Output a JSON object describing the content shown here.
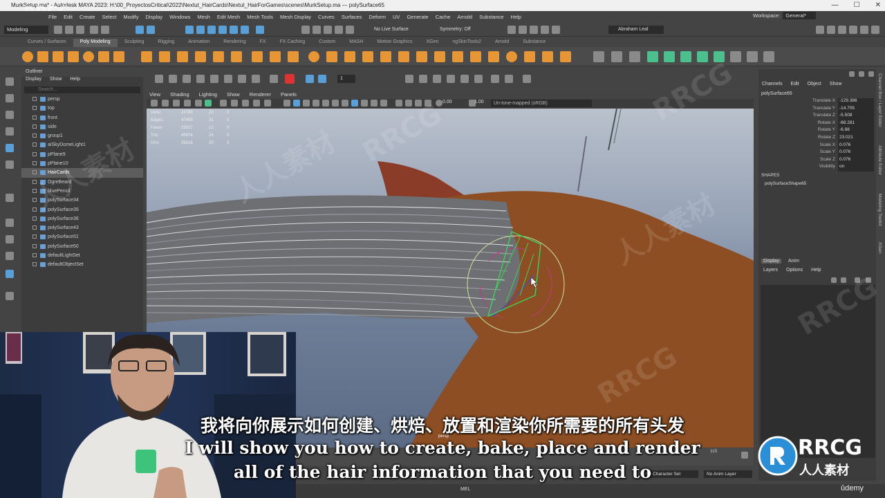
{
  "window": {
    "title": "MurkSetup.ma* - Autodesk MAYA 2023: H:\\00_ProyectosCritical\\2022\\Nextut_HairCards\\Nextut_HairForGames\\scenes\\MurkSetup.ma  ---  polySurface65",
    "minimize": "—",
    "maximize": "☐",
    "close": "✕"
  },
  "menubar": [
    "File",
    "Edit",
    "Create",
    "Select",
    "Modify",
    "Display",
    "Windows",
    "Mesh",
    "Edit Mesh",
    "Mesh Tools",
    "Mesh Display",
    "Curves",
    "Surfaces",
    "Deform",
    "UV",
    "Generate",
    "Cache",
    "Arnold",
    "Substance",
    "Help"
  ],
  "workspace": {
    "label": "Workspace:",
    "value": "General*"
  },
  "statusline": {
    "mode": "Modeling",
    "live_surface": "No Live Surface",
    "symmetry": "Symmetry: Off",
    "user": "Abraham Leal"
  },
  "shelf_tabs": [
    "Curves / Surfaces",
    "Poly Modeling",
    "Sculpting",
    "Rigging",
    "Animation",
    "Rendering",
    "FX",
    "FX Caching",
    "Custom",
    "MASH",
    "Motion Graphics",
    "XGen",
    "ngSkinTools2",
    "Arnold",
    "Substance"
  ],
  "shelf_active": "Poly Modeling",
  "outliner": {
    "title": "Outliner",
    "menu": [
      "Display",
      "Show",
      "Help"
    ],
    "search_placeholder": "Search...",
    "items": [
      {
        "label": "persp",
        "selected": false
      },
      {
        "label": "top",
        "selected": false
      },
      {
        "label": "front",
        "selected": false
      },
      {
        "label": "side",
        "selected": false
      },
      {
        "label": "group1",
        "selected": false
      },
      {
        "label": "aiSkyDomeLight1",
        "selected": false
      },
      {
        "label": "pPlane9",
        "selected": false
      },
      {
        "label": "pPlane10",
        "selected": false
      },
      {
        "label": "HairCards",
        "selected": true
      },
      {
        "label": "OgreBeard",
        "selected": false
      },
      {
        "label": "bluePencil",
        "selected": false
      },
      {
        "label": "polySurface34",
        "selected": false
      },
      {
        "label": "polySurface35",
        "selected": false
      },
      {
        "label": "polySurface36",
        "selected": false
      },
      {
        "label": "polySurface43",
        "selected": false
      },
      {
        "label": "polySurface51",
        "selected": false
      },
      {
        "label": "polySurface50",
        "selected": false
      },
      {
        "label": "defaultLightSet",
        "selected": false
      },
      {
        "label": "defaultObjectSet",
        "selected": false
      }
    ]
  },
  "viewport": {
    "panel_menu": [
      "View",
      "Shading",
      "Lighting",
      "Show",
      "Renderer",
      "Panels"
    ],
    "exposure": "0.00",
    "gamma": "1.00",
    "colorspace": "Un-tone-mapped (sRGB)",
    "brush_size": "1",
    "camera": "persp",
    "hud": [
      {
        "label": "Verts:",
        "a": "24780",
        "b": "20",
        "c": "0"
      },
      {
        "label": "Edges:",
        "a": "47493",
        "b": "31",
        "c": "0"
      },
      {
        "label": "Faces:",
        "a": "23027",
        "b": "12",
        "c": "0"
      },
      {
        "label": "Tris:",
        "a": "45974",
        "b": "24",
        "c": "0"
      },
      {
        "label": "UVs:",
        "a": "25816",
        "b": "20",
        "c": "0"
      }
    ]
  },
  "timeline": {
    "frame_mark": "115"
  },
  "rangebar": {
    "character_set": "No Character Set",
    "anim_layer": "No Anim Layer"
  },
  "cmdline": {
    "lang": "MEL"
  },
  "channelbox": {
    "menu": [
      "Channels",
      "Edit",
      "Object",
      "Show"
    ],
    "node": "polySurface65",
    "attrs": [
      {
        "label": "Translate X",
        "value": "-129.386"
      },
      {
        "label": "Translate Y",
        "value": "-14.705"
      },
      {
        "label": "Translate Z",
        "value": "-5.508"
      },
      {
        "label": "Rotate X",
        "value": "-68.281"
      },
      {
        "label": "Rotate Y",
        "value": "-6.88"
      },
      {
        "label": "Rotate Z",
        "value": "23.021"
      },
      {
        "label": "Scale X",
        "value": "0.076"
      },
      {
        "label": "Scale Y",
        "value": "0.076"
      },
      {
        "label": "Scale Z",
        "value": "0.076"
      },
      {
        "label": "Visibility",
        "value": "on"
      }
    ],
    "shapes_label": "SHAPES",
    "shape_name": "polySurfaceShape65",
    "layer_tabs": [
      "Display",
      "Anim"
    ],
    "layer_menu": [
      "Layers",
      "Options",
      "Help"
    ]
  },
  "side_strip": [
    "Channel Box / Layer Editor",
    "Attribute Editor",
    "Modeling Toolkit",
    "XGen"
  ],
  "subtitles": {
    "cn": "我将向你展示如何创建、烘焙、放置和渲染你所需要的所有头发",
    "en1": "I will show you how to create, bake, place and render",
    "en2": "all of the hair information that you need to"
  },
  "watermark": {
    "rrcg": "RRCG",
    "cn": "人人素材"
  },
  "branding": {
    "logo": "RRCG",
    "logo_sub": "人人素材",
    "udemy": "ûdemy"
  },
  "colors": {
    "selection": "#5d5d5d",
    "panel": "#3c3c3c",
    "shelf_icon_orange": "#e79636",
    "shelf_icon_green": "#4bc08e"
  }
}
